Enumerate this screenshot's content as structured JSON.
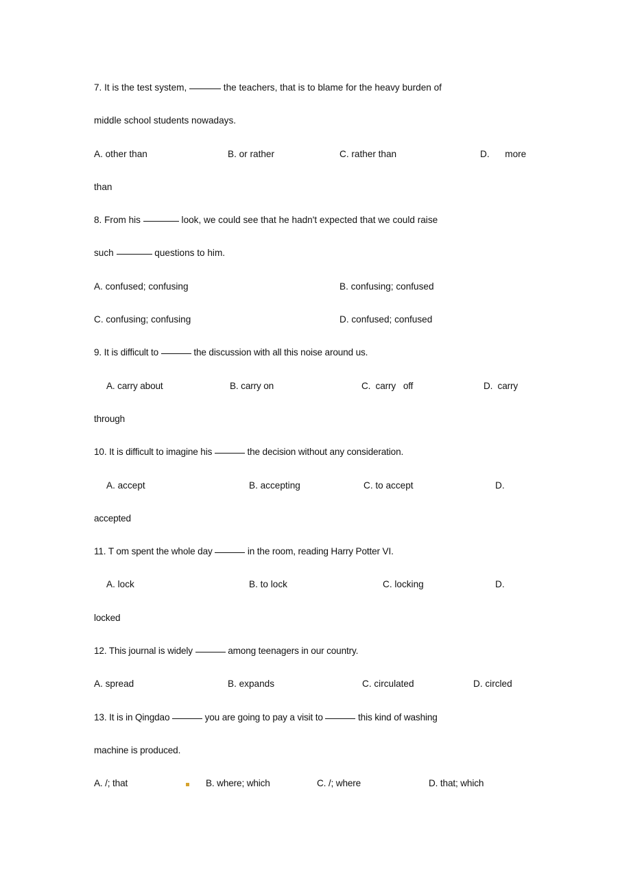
{
  "document": {
    "page_background": "#ffffff",
    "text_color": "#111111",
    "artifact_color": "#d6a32e"
  },
  "questions": [
    {
      "id": "q7",
      "number": "7.",
      "stem_line1_a": "7. It is the test system, ",
      "stem_line1_b": " the teachers, that is to blame for the heavy burden of",
      "stem_line2": "middle school students nowadays.",
      "options": {
        "a": "A. other than",
        "b": "B. or rather",
        "c": "C. rather than",
        "d": "D.      more",
        "d_wrap": "than"
      }
    },
    {
      "id": "q8",
      "number": "8.",
      "stem_line1_a": "8. From his ",
      "stem_line1_b": " look, we could see that he hadn't expected that we could raise",
      "stem_line2_a": "such ",
      "stem_line2_b": " questions to him.",
      "options": {
        "a": "A. confused; confusing",
        "b": "B. confusing; confused",
        "c": "C. confusing; confusing",
        "d": "D. confused; confused"
      }
    },
    {
      "id": "q9",
      "number": "9.",
      "stem_line1_a": "9. It is difficult to ",
      "stem_line1_b": " the discussion with all this noise around us.",
      "options": {
        "a": "A. carry about",
        "b": "B. carry on",
        "c": "C.  carry   off",
        "d": "D.  carry",
        "d_wrap": "through"
      }
    },
    {
      "id": "q10",
      "number": "10.",
      "stem_line1_a": "10. It is difficult to imagine his ",
      "stem_line1_b": " the decision without any consideration.",
      "options": {
        "a": "A. accept",
        "b": "B. accepting",
        "c": "C. to accept",
        "d": "D.",
        "d_wrap": "accepted"
      }
    },
    {
      "id": "q11",
      "number": "11.",
      "stem_line1_a": "11. T om spent the whole day ",
      "stem_line1_b": " in the room, reading Harry Potter VI.",
      "options": {
        "a": "A. lock",
        "b": "B. to lock",
        "c": "C. locking",
        "d": "D.",
        "d_wrap": "locked"
      }
    },
    {
      "id": "q12",
      "number": "12.",
      "stem_line1_a": "12. This journal is widely ",
      "stem_line1_b": " among teenagers in our country.",
      "options": {
        "a": "A. spread",
        "b": "B. expands",
        "c": "C. circulated",
        "d": "D. circled"
      }
    },
    {
      "id": "q13",
      "number": "13.",
      "stem_line1_a": "13. It is in Qingdao ",
      "stem_line1_b": " you are going to pay a visit to ",
      "stem_line1_c": " this kind of washing",
      "stem_line2": "machine is produced.",
      "options": {
        "a": "A. /; that",
        "b": "B. where; which",
        "c": "C. /; where",
        "d": "D. that; which"
      }
    }
  ]
}
